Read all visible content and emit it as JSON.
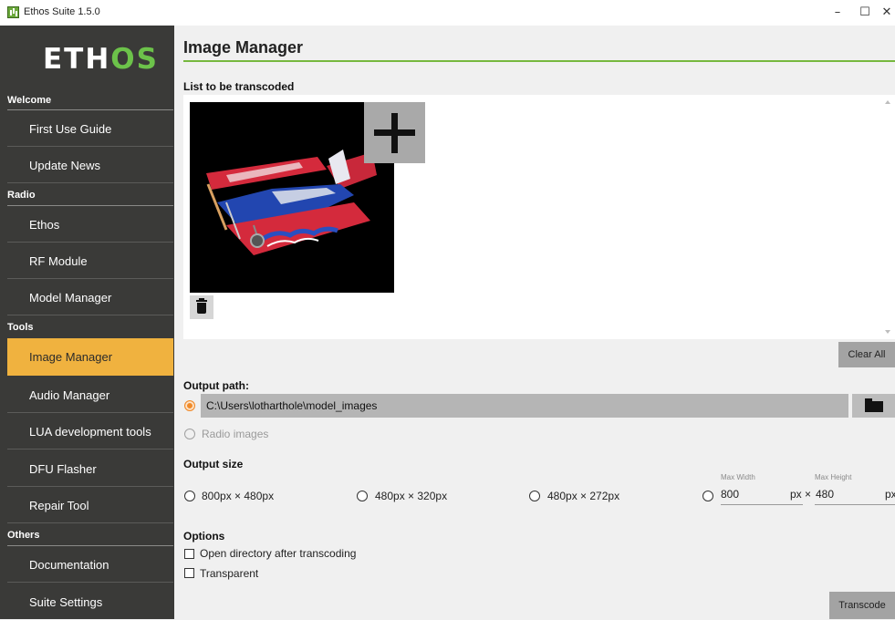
{
  "window": {
    "title": "Ethos Suite 1.5.0",
    "minimize": "–",
    "maximize": "☐",
    "close": "✕"
  },
  "sidebar": {
    "logo": {
      "prefix": "ETH",
      "suffix": "OS"
    },
    "sections": {
      "welcome": "Welcome",
      "radio": "Radio",
      "tools": "Tools",
      "others": "Others"
    },
    "items": {
      "first_use_guide": "First Use Guide",
      "update_news": "Update News",
      "ethos": "Ethos",
      "rf_module": "RF Module",
      "model_manager": "Model Manager",
      "image_manager": "Image Manager",
      "audio_manager": "Audio Manager",
      "lua_tools": "LUA development tools",
      "dfu_flasher": "DFU Flasher",
      "repair_tool": "Repair Tool",
      "documentation": "Documentation",
      "suite_settings": "Suite Settings"
    },
    "active_item": "Image Manager"
  },
  "main": {
    "title": "Image Manager",
    "list_label": "List to be transcoded",
    "clear_all": "Clear All",
    "output_path_label": "Output path:",
    "output_path_value": "C:\\Users\\lotharthole\\model_images",
    "radio_images_label": "Radio images",
    "output_size_label": "Output size",
    "sizes": {
      "s1": "800px × 480px",
      "s2": "480px × 320px",
      "s3": "480px × 272px"
    },
    "custom": {
      "max_width_label": "Max Width",
      "max_height_label": "Max Height",
      "width": "800",
      "height": "480",
      "px1": "px ×",
      "px2": "px"
    },
    "options_label": "Options",
    "open_dir_label": "Open directory after transcoding",
    "transparent_label": "Transparent",
    "transcode": "Transcode"
  },
  "colors": {
    "accent_green": "#76b83e",
    "active_item": "#f0b23f",
    "sidebar": "#3a3a38"
  }
}
